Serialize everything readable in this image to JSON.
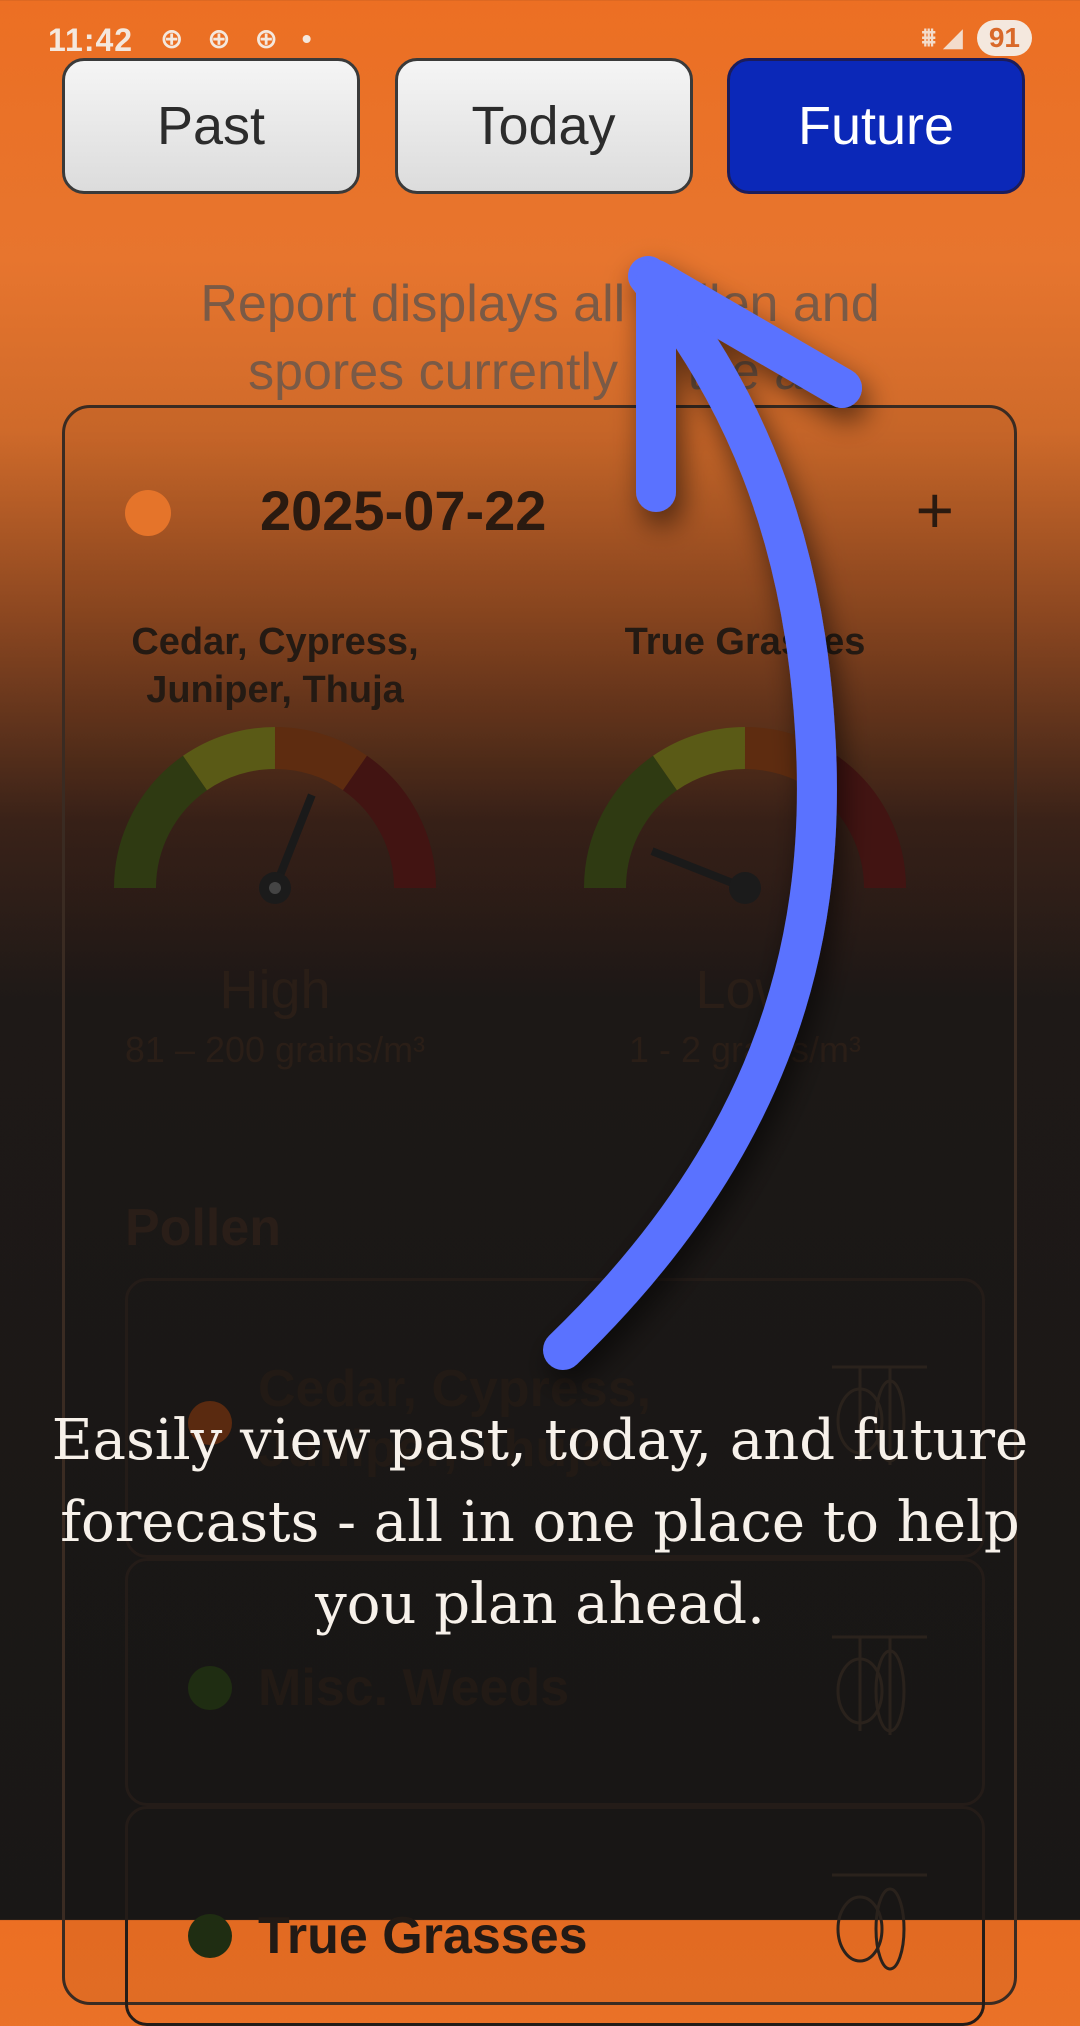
{
  "status_bar": {
    "time": "11:42",
    "notification_icons": "⊕ ⊕ ⊕ •",
    "signal": "⩩ ◢",
    "battery": "91"
  },
  "tabs": [
    {
      "label": "Past",
      "active": false
    },
    {
      "label": "Today",
      "active": false
    },
    {
      "label": "Future",
      "active": true
    }
  ],
  "report_text": "Report displays all pollen and spores currently in the air",
  "card": {
    "date": "2025-07-22",
    "plus_symbol": "+",
    "date_dot_color": "#e5742a",
    "gauges": [
      {
        "name": "Cedar, Cypress, Juniper, Thuja",
        "level": "High",
        "range": "81 – 200 grains/m³",
        "value_fraction": 0.62
      },
      {
        "name": "True Grasses",
        "level": "Low",
        "range": "1 - 2 grains/m³",
        "value_fraction": 0.12
      }
    ]
  },
  "pollen_section": {
    "title": "Pollen",
    "items": [
      {
        "name": "Cedar, Cypress, Juniper, Thuja",
        "dot_color": "#5a2a10"
      },
      {
        "name": "Misc. Weeds",
        "dot_color": "#1f2d12"
      },
      {
        "name": "True Grasses",
        "dot_color": "#1f2d12"
      }
    ]
  },
  "caption": "Easily view  past, today, and future forecasts - all in one place to help you plan ahead.",
  "colors": {
    "accent_orange": "#ec6f23",
    "active_tab": "#0b28b8",
    "arrow": "#5a72ff"
  }
}
